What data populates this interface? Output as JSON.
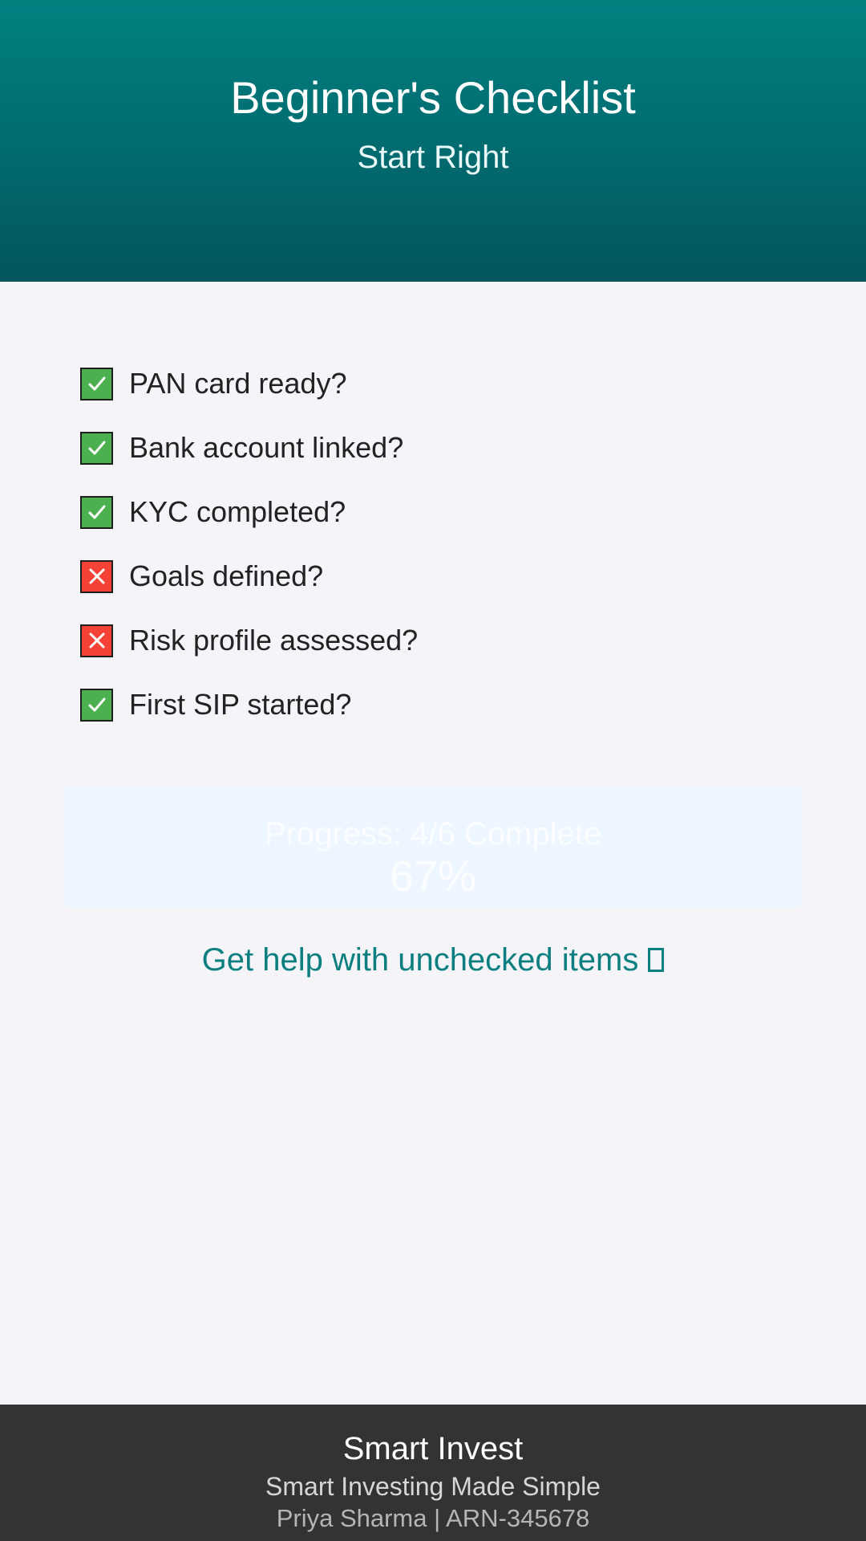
{
  "header": {
    "title": "Beginner's Checklist",
    "subtitle": "Start Right"
  },
  "colors": {
    "header_top": "#018080",
    "header_bottom": "#03555c",
    "checked": "#4caf50",
    "unchecked": "#f44336",
    "link": "#0b7f7f",
    "footer_bg": "#333333"
  },
  "checklist": {
    "items": [
      {
        "label": "PAN card ready?",
        "checked": true
      },
      {
        "label": "Bank account linked?",
        "checked": true
      },
      {
        "label": "KYC completed?",
        "checked": true
      },
      {
        "label": "Goals defined?",
        "checked": false
      },
      {
        "label": "Risk profile assessed?",
        "checked": false
      },
      {
        "label": "First SIP started?",
        "checked": true
      }
    ]
  },
  "progress": {
    "text": "Progress: 4/6 Complete",
    "percent_text": "67%"
  },
  "help_link": {
    "label": "Get help with unchecked items",
    "icon": "external-link-icon"
  },
  "footer": {
    "brand": "Smart Invest",
    "tagline": "Smart Investing Made Simple",
    "advisor": "Priya Sharma | ARN-345678"
  }
}
